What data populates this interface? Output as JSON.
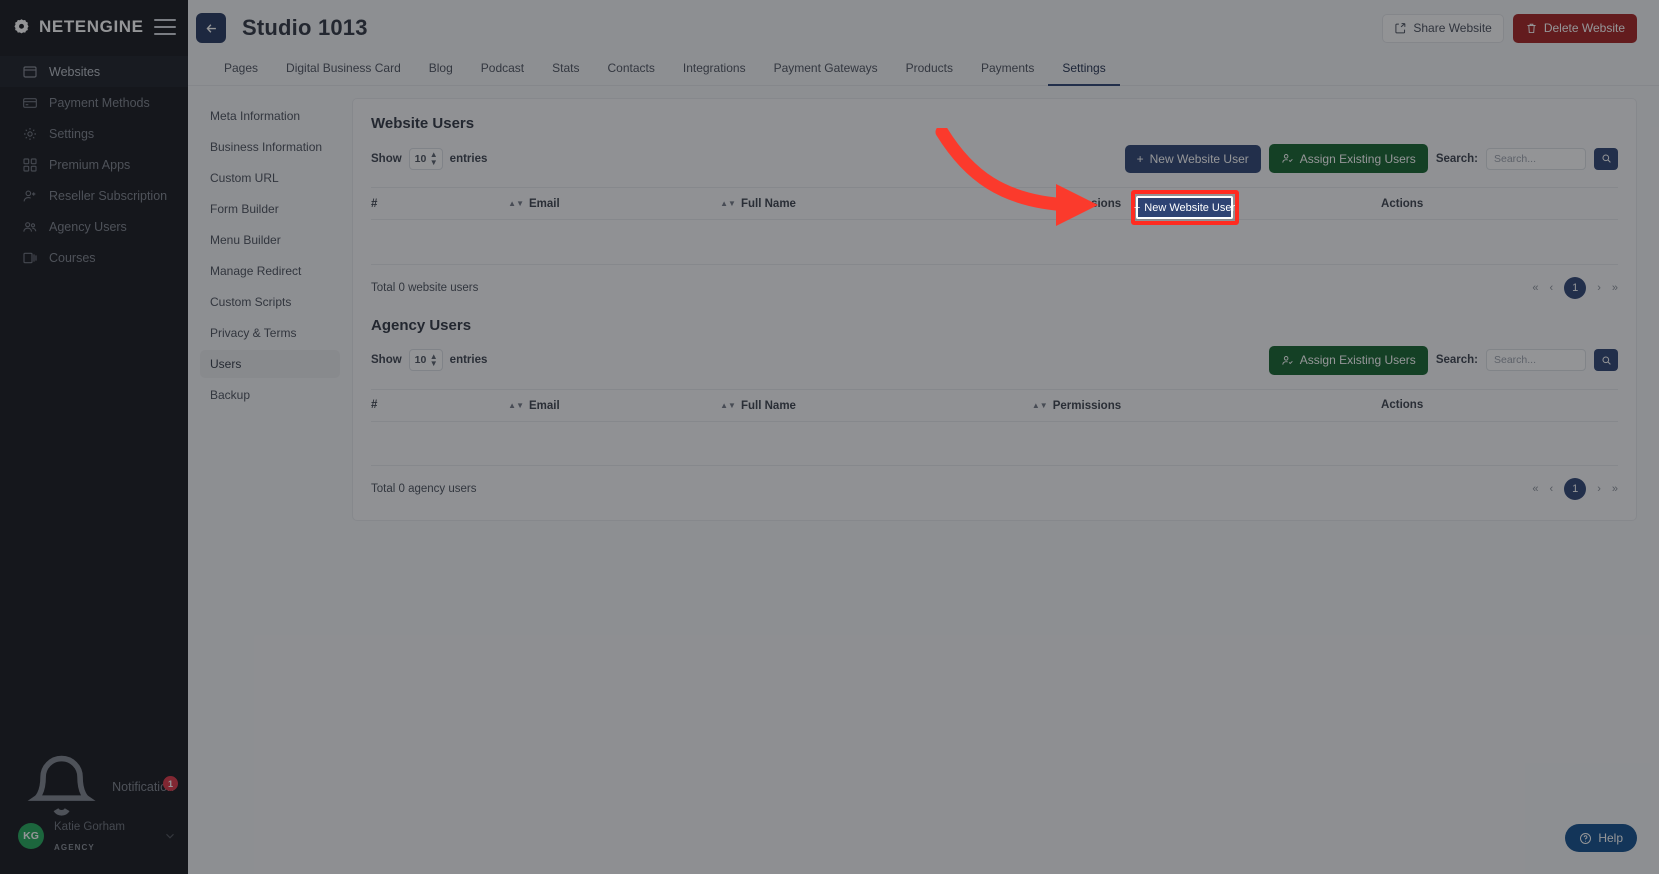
{
  "brand": {
    "name": "NETENGINE",
    "logo_icon": "gear-logo-icon",
    "menu_icon": "hamburger-menu-icon"
  },
  "sidebar": {
    "items": [
      {
        "label": "Websites",
        "icon": "browser-window-icon",
        "active": true
      },
      {
        "label": "Payment Methods",
        "icon": "credit-card-icon",
        "active": false
      },
      {
        "label": "Settings",
        "icon": "gear-icon",
        "active": false
      },
      {
        "label": "Premium Apps",
        "icon": "apps-grid-icon",
        "active": false
      },
      {
        "label": "Reseller Subscription",
        "icon": "user-plus-icon",
        "active": false
      },
      {
        "label": "Agency Users",
        "icon": "users-group-icon",
        "active": false
      },
      {
        "label": "Courses",
        "icon": "book-icon",
        "active": false
      }
    ],
    "notification": {
      "label": "Notification",
      "icon": "bell-icon",
      "badge": "1"
    },
    "profile": {
      "initials": "KG",
      "name": "Katie Gorham",
      "role": "AGENCY",
      "chevron_icon": "chevron-down-icon"
    }
  },
  "header": {
    "back_icon": "arrow-left-icon",
    "title": "Studio 1013",
    "share_label": "Share Website",
    "share_icon": "share-icon",
    "delete_label": "Delete Website",
    "delete_icon": "trash-icon"
  },
  "tabs": [
    {
      "label": "Pages",
      "active": false
    },
    {
      "label": "Digital Business Card",
      "active": false
    },
    {
      "label": "Blog",
      "active": false
    },
    {
      "label": "Podcast",
      "active": false
    },
    {
      "label": "Stats",
      "active": false
    },
    {
      "label": "Contacts",
      "active": false
    },
    {
      "label": "Integrations",
      "active": false
    },
    {
      "label": "Payment Gateways",
      "active": false
    },
    {
      "label": "Products",
      "active": false
    },
    {
      "label": "Payments",
      "active": false
    },
    {
      "label": "Settings",
      "active": true
    }
  ],
  "subnav": [
    {
      "label": "Meta Information",
      "active": false
    },
    {
      "label": "Business Information",
      "active": false
    },
    {
      "label": "Custom URL",
      "active": false
    },
    {
      "label": "Form Builder",
      "active": false
    },
    {
      "label": "Menu Builder",
      "active": false
    },
    {
      "label": "Manage Redirect",
      "active": false
    },
    {
      "label": "Custom Scripts",
      "active": false
    },
    {
      "label": "Privacy & Terms",
      "active": false
    },
    {
      "label": "Users",
      "active": true
    },
    {
      "label": "Backup",
      "active": false
    }
  ],
  "website_users": {
    "title": "Website Users",
    "show_label": "Show",
    "entries_label": "entries",
    "page_size": "10",
    "new_user_label": "New Website User",
    "new_user_icon": "plus-icon",
    "assign_label": "Assign Existing Users",
    "assign_icon": "user-check-icon",
    "search_label": "Search:",
    "search_placeholder": "Search...",
    "search_value": "",
    "search_icon": "magnifier-icon",
    "columns": [
      "#",
      "Email",
      "Full Name",
      "Permissions",
      "Actions"
    ],
    "rows": [],
    "total_text": "Total 0 website users",
    "pager": {
      "first": "«",
      "prev": "‹",
      "current": "1",
      "next": "›",
      "last": "»"
    }
  },
  "agency_users": {
    "title": "Agency Users",
    "show_label": "Show",
    "entries_label": "entries",
    "page_size": "10",
    "assign_label": "Assign Existing Users",
    "assign_icon": "user-check-icon",
    "search_label": "Search:",
    "search_placeholder": "Search...",
    "search_value": "",
    "search_icon": "magnifier-icon",
    "columns": [
      "#",
      "Email",
      "Full Name",
      "Permissions",
      "Actions"
    ],
    "rows": [],
    "total_text": "Total 0 agency users",
    "pager": {
      "first": "«",
      "prev": "‹",
      "current": "1",
      "next": "›",
      "last": "»"
    }
  },
  "help": {
    "label": "Help",
    "icon": "question-circle-icon"
  },
  "annotation": {
    "target_label": "New Website User",
    "box_color": "#ff2b20",
    "arrow_color": "#fb3a2c"
  },
  "colors": {
    "accent": "#2e4373",
    "danger": "#a52121",
    "success": "#14632e",
    "sidebar_bg": "#15171c",
    "avatar_bg": "#22a85a",
    "badge": "#dc3545"
  }
}
